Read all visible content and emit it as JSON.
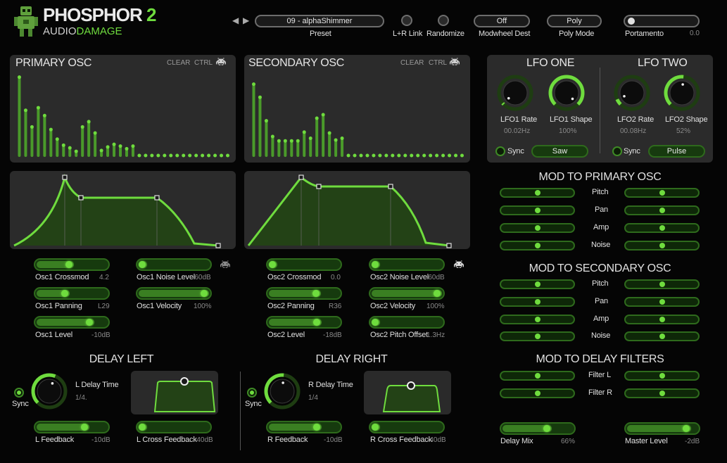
{
  "brand": {
    "name": "PHOSPHOR",
    "version": "2",
    "maker_a": "AUDIO",
    "maker_b": "DAMAGE",
    "prev_glyph": "◀",
    "next_glyph": "▶"
  },
  "header": {
    "preset_value": "09 - alphaShimmer",
    "preset_label": "Preset",
    "lr_link_label": "L+R Link",
    "randomize_label": "Randomize",
    "modwheel_value": "Off",
    "modwheel_label": "Modwheel Dest",
    "polymode_value": "Poly",
    "polymode_label": "Poly Mode",
    "portamento_label": "Portamento",
    "portamento_value": "0.0"
  },
  "primary_osc": {
    "title": "PRIMARY OSC",
    "clear": "CLEAR",
    "ctrl": "CTRL",
    "harmonics": [
      0.93,
      0.55,
      0.36,
      0.58,
      0.49,
      0.33,
      0.22,
      0.15,
      0.12,
      0.08,
      0.36,
      0.42,
      0.29,
      0.09,
      0.13,
      0.16,
      0.14,
      0.11,
      0.14,
      0.03,
      0.03,
      0.03,
      0.03,
      0.03,
      0.03,
      0.03,
      0.03,
      0.03,
      0.03,
      0.03,
      0.03,
      0.03,
      0.03,
      0.03
    ]
  },
  "secondary_osc": {
    "title": "SECONDARY OSC",
    "clear": "CLEAR",
    "ctrl": "CTRL",
    "harmonics": [
      0.85,
      0.7,
      0.43,
      0.25,
      0.2,
      0.2,
      0.2,
      0.2,
      0.3,
      0.23,
      0.46,
      0.5,
      0.29,
      0.21,
      0.23,
      0.03,
      0.03,
      0.03,
      0.03,
      0.03,
      0.03,
      0.03,
      0.03,
      0.03,
      0.03,
      0.03,
      0.03,
      0.03,
      0.03,
      0.03,
      0.03,
      0.03,
      0.03,
      0.03
    ]
  },
  "osc1": {
    "crossmod": {
      "label": "Osc1 Crossmod",
      "value": "4.2",
      "level": 0.47
    },
    "noise": {
      "label": "Osc1 Noise Level",
      "value": "-60dB",
      "level": 0.0
    },
    "panning": {
      "label": "Osc1 Panning",
      "value": "L29",
      "level": 0.4
    },
    "velocity": {
      "label": "Osc1 Velocity",
      "value": "100%",
      "level": 1.0
    },
    "level": {
      "label": "Osc1 Level",
      "value": "-10dB",
      "level": 0.8
    }
  },
  "osc2": {
    "crossmod": {
      "label": "Osc2 Crossmod",
      "value": "0.0",
      "level": 0.0
    },
    "noise": {
      "label": "Osc2 Noise Level",
      "value": "-60dB",
      "level": 0.0
    },
    "panning": {
      "label": "Osc2 Panning",
      "value": "R36",
      "level": 0.7
    },
    "velocity": {
      "label": "Osc2 Velocity",
      "value": "100%",
      "level": 1.0
    },
    "level": {
      "label": "Osc2 Level",
      "value": "-18dB",
      "level": 0.72
    },
    "pitch": {
      "label": "Osc2 Pitch Offset",
      "value": "1.3Hz",
      "level": 0.0
    }
  },
  "lfo_one": {
    "title": "LFO ONE",
    "rate_label": "LFO1 Rate",
    "rate_value": "00.02Hz",
    "rate_level": 0.02,
    "shape_label": "LFO1 Shape",
    "shape_value": "100%",
    "shape_level": 1.0,
    "sync_label": "Sync",
    "wave": "Saw"
  },
  "lfo_two": {
    "title": "LFO TWO",
    "rate_label": "LFO2 Rate",
    "rate_value": "00.08Hz",
    "rate_level": 0.08,
    "shape_label": "LFO2 Shape",
    "shape_value": "52%",
    "shape_level": 0.52,
    "sync_label": "Sync",
    "wave": "Pulse"
  },
  "mod_primary": {
    "title": "MOD TO PRIMARY OSC",
    "rows": [
      "Pitch",
      "Pan",
      "Amp",
      "Noise"
    ]
  },
  "mod_secondary": {
    "title": "MOD TO SECONDARY OSC",
    "rows": [
      "Pitch",
      "Pan",
      "Amp",
      "Noise"
    ]
  },
  "mod_delay": {
    "title": "MOD TO DELAY FILTERS",
    "rows": [
      "Filter L",
      "Filter R"
    ]
  },
  "delay_left": {
    "title": "DELAY LEFT",
    "sync_label": "Sync",
    "time_label": "L Delay Time",
    "time_value": "1/4.",
    "feedback_label": "L Feedback",
    "feedback_value": "-10dB",
    "feedback_level": 0.72,
    "cross_label": "L Cross Feedback",
    "cross_value": "-40dB",
    "cross_level": 0.0
  },
  "delay_right": {
    "title": "DELAY RIGHT",
    "sync_label": "Sync",
    "time_label": "R Delay Time",
    "time_value": "1/4",
    "feedback_label": "R Feedback",
    "feedback_value": "-10dB",
    "feedback_level": 0.72,
    "cross_label": "R Cross Feedback",
    "cross_value": "-40dB",
    "cross_level": 0.0
  },
  "output": {
    "delay_mix_label": "Delay Mix",
    "delay_mix_value": "66%",
    "delay_mix_level": 0.66,
    "master_label": "Master Level",
    "master_value": "-2dB",
    "master_level": 0.9
  },
  "colors": {
    "accent": "#6fdc3e",
    "panel": "#2b2b2b",
    "bg": "#050505"
  }
}
